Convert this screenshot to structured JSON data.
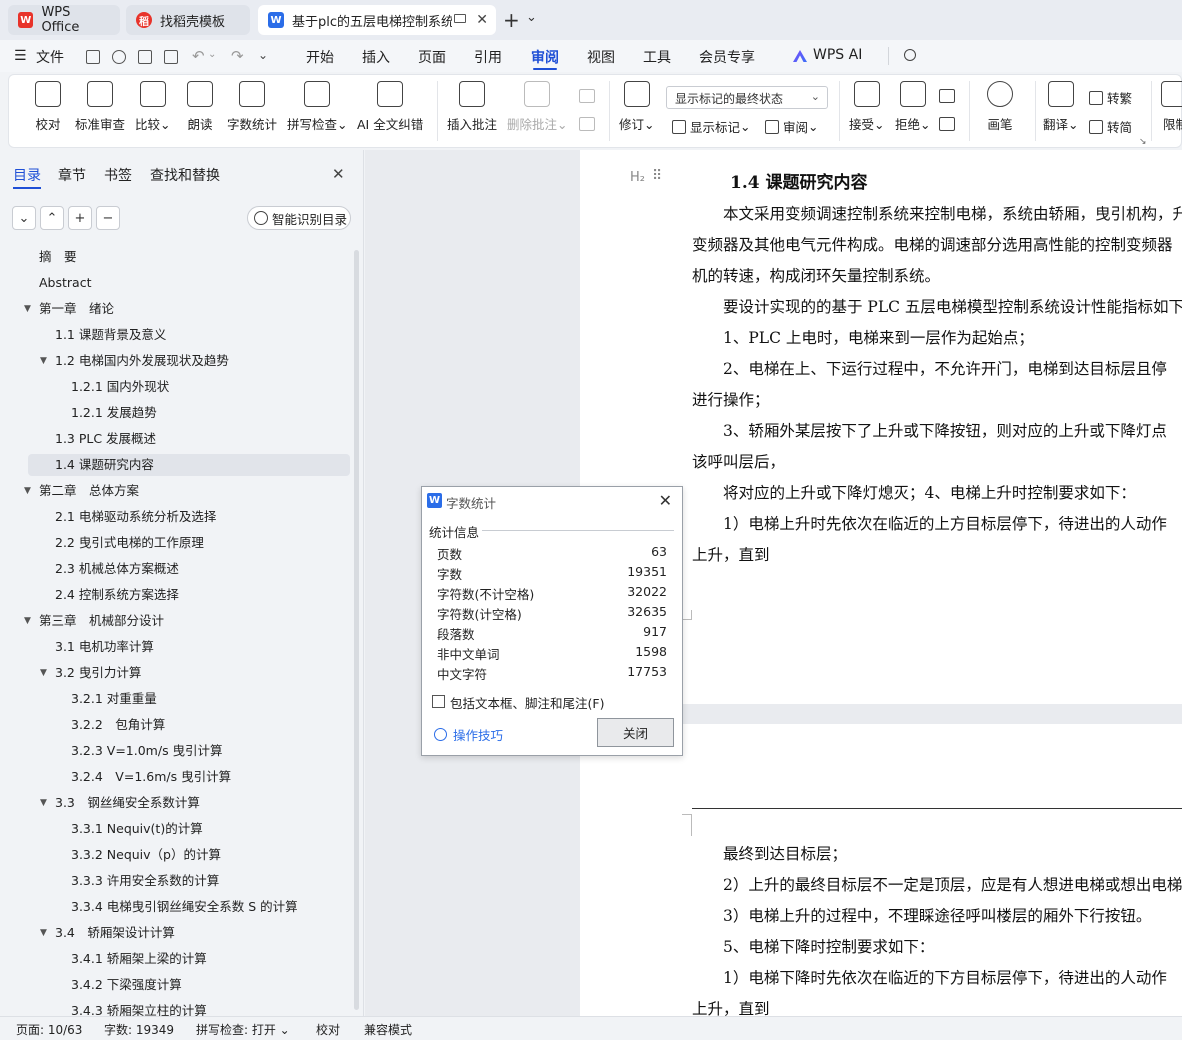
{
  "titlebar": {
    "tabs": [
      {
        "label": "WPS Office",
        "icon": "wps-logo-icon"
      },
      {
        "label": "找稻壳模板",
        "icon": "docer-icon"
      },
      {
        "label": "基于plc的五层电梯控制系统设",
        "icon": "word-doc-icon"
      }
    ],
    "new_tab": "+",
    "more": "⌄"
  },
  "menubar": {
    "file": "文件",
    "items": [
      "开始",
      "插入",
      "页面",
      "引用",
      "审阅",
      "视图",
      "工具",
      "会员专享",
      "WPS AI"
    ],
    "active": "审阅"
  },
  "ribbon": {
    "proofread": "校对",
    "std_review": "标准审查",
    "compare": "比较",
    "read_aloud": "朗读",
    "word_count": "字数统计",
    "spell_check": "拼写检查",
    "ai_proof": "AI 全文纠错",
    "insert_comment": "插入批注",
    "delete_comment": "删除批注",
    "track": "修订",
    "markup_select": "显示标记的最终状态",
    "show_markup": "显示标记",
    "review": "审阅",
    "accept": "接受",
    "reject": "拒绝",
    "pen": "画笔",
    "translate": "翻译",
    "to_trad": "转繁",
    "to_simp": "转简",
    "restrict": "限制"
  },
  "nav": {
    "tabs": [
      "目录",
      "章节",
      "书签",
      "查找和替换"
    ],
    "smart_toc": "智能识别目录",
    "toc": [
      {
        "label": "摘　要",
        "level": 0
      },
      {
        "label": "Abstract",
        "level": 0
      },
      {
        "label": "第一章　绪论",
        "level": 0,
        "expanded": true
      },
      {
        "label": "1.1 课题背景及意义",
        "level": 1
      },
      {
        "label": "1.2 电梯国内外发展现状及趋势",
        "level": 1,
        "expanded": true
      },
      {
        "label": "1.2.1 国内外现状",
        "level": 2
      },
      {
        "label": "1.2.1 发展趋势",
        "level": 2
      },
      {
        "label": "1.3 PLC 发展概述",
        "level": 1
      },
      {
        "label": "1.4  课题研究内容",
        "level": 1,
        "selected": true
      },
      {
        "label": "第二章　总体方案",
        "level": 0,
        "expanded": true
      },
      {
        "label": "2.1 电梯驱动系统分析及选择",
        "level": 1
      },
      {
        "label": "2.2 曳引式电梯的工作原理",
        "level": 1
      },
      {
        "label": "2.3 机械总体方案概述",
        "level": 1
      },
      {
        "label": "2.4 控制系统方案选择",
        "level": 1
      },
      {
        "label": "第三章　机械部分设计",
        "level": 0,
        "expanded": true
      },
      {
        "label": "3.1  电机功率计算",
        "level": 1
      },
      {
        "label": "3.2 曳引力计算",
        "level": 1,
        "expanded": true
      },
      {
        "label": "3.2.1  对重重量",
        "level": 2
      },
      {
        "label": "3.2.2　包角计算",
        "level": 2
      },
      {
        "label": "3.2.3  V=1.0m/s 曳引计算",
        "level": 2
      },
      {
        "label": "3.2.4　V=1.6m/s 曳引计算",
        "level": 2
      },
      {
        "label": "3.3　钢丝绳安全系数计算",
        "level": 1,
        "expanded": true
      },
      {
        "label": "3.3.1 Nequiv(t)的计算",
        "level": 2
      },
      {
        "label": "3.3.2 Nequiv（p）的计算",
        "level": 2
      },
      {
        "label": "3.3.3 许用安全系数的计算",
        "level": 2
      },
      {
        "label": "3.3.4 电梯曳引钢丝绳安全系数 S 的计算",
        "level": 2
      },
      {
        "label": "3.4　轿厢架设计计算",
        "level": 1,
        "expanded": true
      },
      {
        "label": "3.4.1 轿厢架上梁的计算",
        "level": 2
      },
      {
        "label": "3.4.2 下梁强度计算",
        "level": 2
      },
      {
        "label": "3.4.3 轿厢架立柱的计算",
        "level": 2
      }
    ]
  },
  "document": {
    "heading_marker": "H₂",
    "heading": "1.4  课题研究内容",
    "page1_lines": [
      "　　本文采用变频调速控制系统来控制电梯，系统由轿厢，曳引机构，升",
      "变频器及其他电气元件构成。电梯的调速部分选用高性能的控制变频器",
      "机的转速，构成闭环矢量控制系统。",
      "　　要设计实现的的基于 PLC 五层电梯模型控制系统设计性能指标如下",
      "　　1、PLC 上电时，电梯来到一层作为起始点；",
      "　　2、电梯在上、下运行过程中，不允许开门，电梯到达目标层且停",
      "进行操作；",
      "　　3、轿厢外某层按下了上升或下降按钮，则对应的上升或下降灯点",
      "该呼叫层后，",
      "　　将对应的上升或下降灯熄灭；4、电梯上升时控制要求如下：",
      "　　1）电梯上升时先依次在临近的上方目标层停下，待进出的人动作",
      "上升，直到"
    ],
    "page2_lines": [
      "　　最终到达目标层；",
      "　　2）上升的最终目标层不一定是顶层，应是有人想进电梯或想出电梯",
      "　　3）电梯上升的过程中，不理睬途径呼叫楼层的厢外下行按钮。",
      "　　5、电梯下降时控制要求如下：",
      "　　1）电梯下降时先依次在临近的下方目标层停下，待进出的人动作",
      "上升，直到"
    ]
  },
  "dialog": {
    "title": "字数统计",
    "section": "统计信息",
    "stats": [
      {
        "label": "页数",
        "value": "63"
      },
      {
        "label": "字数",
        "value": "19351"
      },
      {
        "label": "字符数(不计空格)",
        "value": "32022"
      },
      {
        "label": "字符数(计空格)",
        "value": "32635"
      },
      {
        "label": "段落数",
        "value": "917"
      },
      {
        "label": "非中文单词",
        "value": "1598"
      },
      {
        "label": "中文字符",
        "value": "17753"
      }
    ],
    "include_label": "包括文本框、脚注和尾注(F)",
    "include_checked": false,
    "tips": "操作技巧",
    "close": "关闭"
  },
  "statusbar": {
    "page": "页面: 10/63",
    "words": "字数: 19349",
    "spell": "拼写检查: 打开",
    "proof": "校对",
    "compat": "兼容模式"
  },
  "colors": {
    "accent": "#1f4fd6",
    "wps_red": "#e8332a",
    "word_blue": "#2b6de8"
  }
}
